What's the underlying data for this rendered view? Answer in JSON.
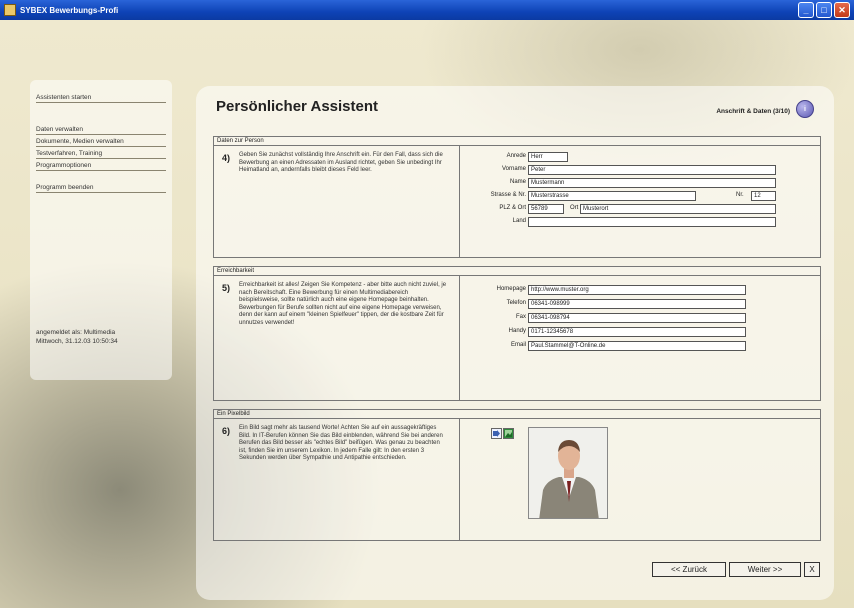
{
  "window": {
    "title": "SYBEX Bewerbungs-Profi"
  },
  "sidebar": {
    "items": [
      "Assistenten starten",
      "Daten verwalten",
      "Dokumente, Medien verwalten",
      "Testverfahren, Training",
      "Programmoptionen",
      "Programm beenden"
    ],
    "status_line1": "angemeldet als: Multimedia",
    "status_line2": "Mittwoch, 31.12.03  10:50:34"
  },
  "header": {
    "title": "Persönlicher Assistent",
    "section": "Anschrift & Daten (3/10)",
    "help_label": "i"
  },
  "person": {
    "legend": "Daten zur Person",
    "number": "4)",
    "description": "Geben Sie zunächst vollständig Ihre Anschrift ein. Für den Fall, dass sich die Bewerbung an einen Adressaten im Ausland richtet, geben Sie unbedingt Ihr Heimatland an, andernfalls bleibt dieses Feld leer.",
    "labels": {
      "anrede": "Anrede",
      "vorname": "Vorname",
      "name": "Name",
      "strasse": "Strasse & Nr.",
      "nr": "Nr.",
      "plz": "PLZ & Ort",
      "ort": "Ort",
      "land": "Land"
    },
    "values": {
      "anrede": "Herr",
      "vorname": "Peter",
      "name": "Mustermann",
      "strasse": "Musterstrasse",
      "nr": "12",
      "plz": "56789",
      "ort": "Musterort",
      "land": ""
    }
  },
  "contact": {
    "legend": "Erreichbarkeit",
    "number": "5)",
    "description": "Erreichbarkeit ist alles! Zeigen Sie Kompetenz - aber bitte auch nicht zuviel, je nach Bereitschaft. Eine Bewerbung für einen Multimediabereich beispielsweise, sollte natürlich auch eine eigene Homepage beinhalten. Bewerbungen für Berufe sollten nicht auf eine eigene Homepage verweisen, denn der kann auf einem \"kleinen Spielfeuer\" tippen, der die kostbare Zeit für unnutzes verwendet!",
    "labels": {
      "homepage": "Homepage",
      "telefon": "Telefon",
      "fax": "Fax",
      "handy": "Handy",
      "email": "Email"
    },
    "values": {
      "homepage": "http://www.muster.org",
      "telefon": "06341-098999",
      "fax": "06341-098794",
      "handy": "0171-12345678",
      "email": "Paul.Stammel@T-Online.de"
    }
  },
  "picture": {
    "legend": "Ein Pixelbild",
    "number": "6)",
    "description": "Ein Bild sagt mehr als tausend Worte! Achten Sie auf ein aussagekräftiges Bild. In IT-Berufen können Sie das Bild einblenden, während Sie bei anderen Berufen das Bild besser als \"echtes Bild\" beifügen. Was genau zu beachten ist, finden Sie im unserem Lexikon. In jedem Falle gilt: In den ersten 3 Sekunden werden über Sympathie und Antipathie entschieden."
  },
  "nav": {
    "back": "<< Zurück",
    "next": "Weiter >>",
    "close": "X"
  }
}
